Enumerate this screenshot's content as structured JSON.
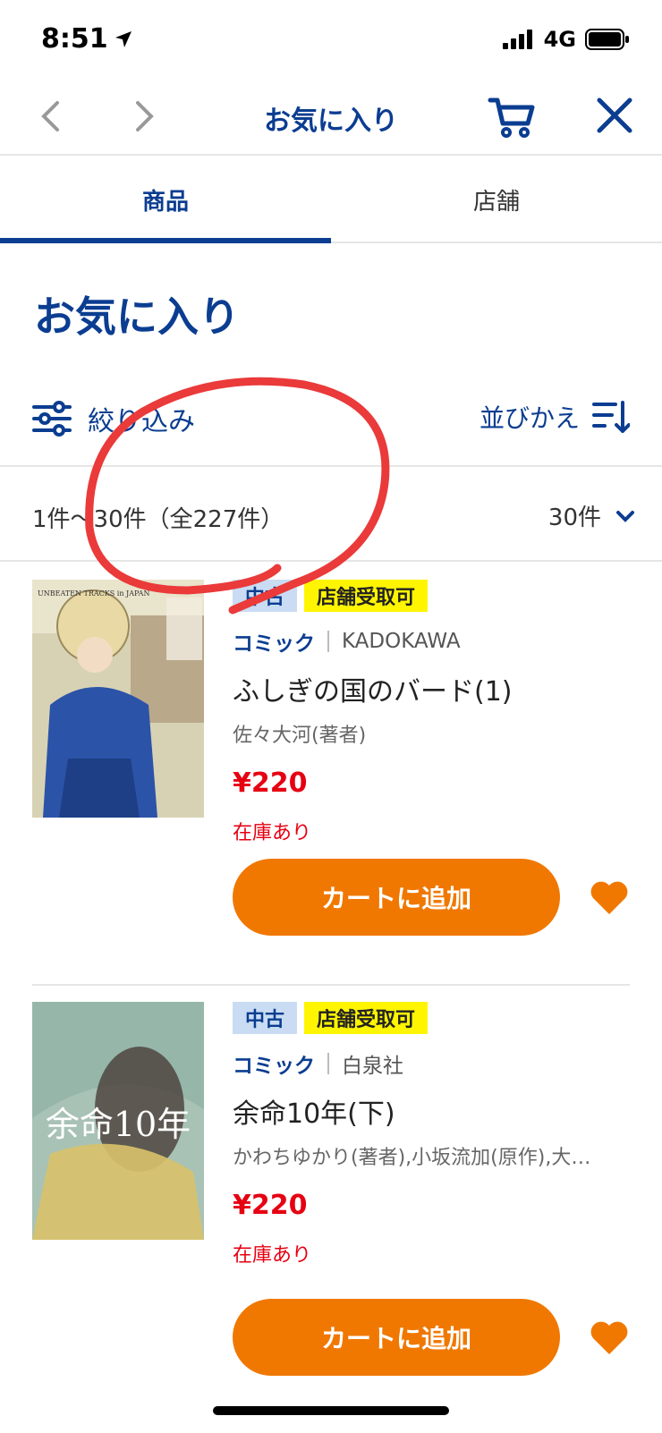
{
  "status_bar": {
    "time": "8:51",
    "network": "4G"
  },
  "nav": {
    "title": "お気に入り"
  },
  "tabs": [
    {
      "label": "商品",
      "active": true
    },
    {
      "label": "店舗",
      "active": false
    }
  ],
  "page_title": "お気に入り",
  "filter": {
    "filter_label": "絞り込み",
    "sort_label": "並びかえ"
  },
  "results": {
    "count_text": "1件〜30件（全227件）",
    "per_page": "30件"
  },
  "products": [
    {
      "badge_condition": "中古",
      "badge_pickup": "店舗受取可",
      "category": "コミック",
      "publisher": "KADOKAWA",
      "title": "ふしぎの国のバード(1)",
      "author": "佐々大河(著者)",
      "price": "¥220",
      "stock": "在庫あり",
      "cart_button": "カートに追加",
      "cover_text": "UNBEATEN TRACKS in JAPAN"
    },
    {
      "badge_condition": "中古",
      "badge_pickup": "店舗受取可",
      "category": "コミック",
      "publisher": "白泉社",
      "title": "余命10年(下)",
      "author": "かわちゆかり(著者),小坂流加(原作),大…",
      "price": "¥220",
      "stock": "在庫あり",
      "cart_button": "カートに追加",
      "cover_text": "余命10年"
    }
  ],
  "colors": {
    "brand": "#0b3d91",
    "accent": "#f07800",
    "price": "#e60012",
    "pickup_badge": "#fff500",
    "used_badge": "#c9dcf3"
  }
}
